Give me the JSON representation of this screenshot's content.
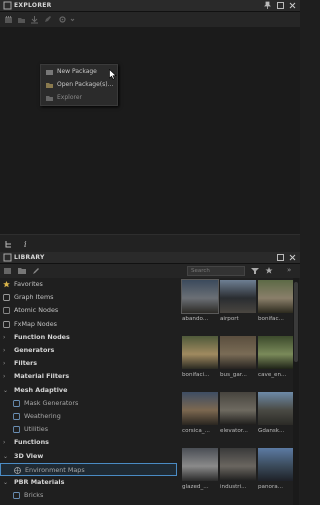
{
  "explorer": {
    "title": "EXPLORER",
    "context_menu": [
      {
        "label": "New Package",
        "icon": "new-package-icon"
      },
      {
        "label": "Open Package(s)...",
        "icon": "open-folder-icon"
      },
      {
        "label": "Explorer",
        "icon": "folder-icon"
      }
    ]
  },
  "library": {
    "title": "LIBRARY",
    "search_placeholder": "Search",
    "tree": [
      {
        "label": "Favorites",
        "icon": "star-icon",
        "kind": "item"
      },
      {
        "label": "Graph Items",
        "icon": "graph-item-icon",
        "kind": "item"
      },
      {
        "label": "Atomic Nodes",
        "icon": "atomic-node-icon",
        "kind": "item"
      },
      {
        "label": "FxMap Nodes",
        "icon": "fxmap-icon",
        "kind": "item"
      },
      {
        "label": "Function Nodes",
        "kind": "group"
      },
      {
        "label": "Generators",
        "kind": "group"
      },
      {
        "label": "Filters",
        "kind": "group"
      },
      {
        "label": "Material Filters",
        "kind": "group"
      },
      {
        "label": "Mesh Adaptive",
        "kind": "group-open"
      },
      {
        "label": "Mask Generators",
        "icon": "mask-icon",
        "kind": "sub"
      },
      {
        "label": "Weathering",
        "icon": "weathering-icon",
        "kind": "sub"
      },
      {
        "label": "Utilities",
        "icon": "utilities-icon",
        "kind": "sub"
      },
      {
        "label": "Functions",
        "kind": "group"
      },
      {
        "label": "3D View",
        "kind": "group-open"
      },
      {
        "label": "Environment Maps",
        "icon": "globe-icon",
        "kind": "selected"
      },
      {
        "label": "PBR Materials",
        "kind": "group-open"
      },
      {
        "label": "Bricks",
        "icon": "brick-icon",
        "kind": "sub"
      }
    ],
    "thumbnails": [
      {
        "label": "abando...",
        "colors": [
          "#3b4a5c",
          "#6b6f75",
          "#2c2a26"
        ]
      },
      {
        "label": "airport",
        "colors": [
          "#6e7f93",
          "#2a2d31",
          "#4a4640"
        ]
      },
      {
        "label": "bonifac...",
        "colors": [
          "#5d6a46",
          "#8a7f6a",
          "#2c2a1e"
        ]
      },
      {
        "label": "bonifaci...",
        "colors": [
          "#4f5a3a",
          "#a08a60",
          "#2a2a22"
        ]
      },
      {
        "label": "bus_gar...",
        "colors": [
          "#5a4e3e",
          "#7a6c56",
          "#262320"
        ]
      },
      {
        "label": "cave_en...",
        "colors": [
          "#3c4a2c",
          "#7a8a5a",
          "#1f2318"
        ]
      },
      {
        "label": "corsica_...",
        "colors": [
          "#3e4d64",
          "#7c6850",
          "#2a2620"
        ]
      },
      {
        "label": "elevator...",
        "colors": [
          "#47443e",
          "#6e6a60",
          "#1f1e1c"
        ]
      },
      {
        "label": "Gdansk...",
        "colors": [
          "#6d8aa8",
          "#4a4a44",
          "#2b2a26"
        ]
      },
      {
        "label": "glazed_...",
        "colors": [
          "#4a4e55",
          "#8a8a8a",
          "#2a2a2a"
        ]
      },
      {
        "label": "industri...",
        "colors": [
          "#3a3a3a",
          "#6a6660",
          "#1f1f1f"
        ]
      },
      {
        "label": "panora...",
        "colors": [
          "#5c7aa3",
          "#3a4a5a",
          "#1e2128"
        ]
      }
    ]
  }
}
